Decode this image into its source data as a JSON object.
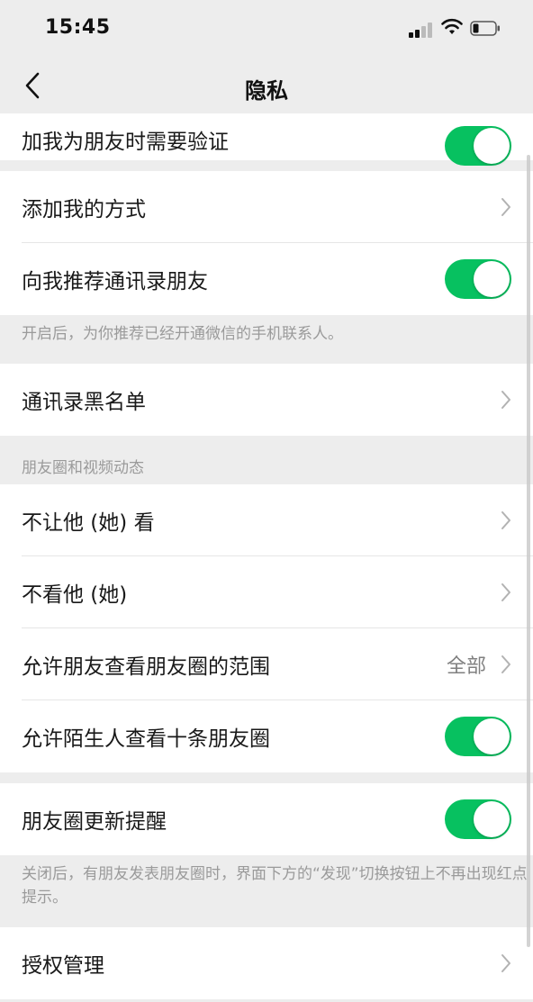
{
  "status_bar": {
    "time": "15:45"
  },
  "nav": {
    "title": "隐私"
  },
  "rows": {
    "verify": {
      "label": "加我为朋友时需要验证",
      "toggle_on": true
    },
    "add_methods": {
      "label": "添加我的方式"
    },
    "recommend_contacts": {
      "label": "向我推荐通讯录朋友",
      "toggle_on": true
    },
    "recommend_note": "开启后，为你推荐已经开通微信的手机联系人。",
    "blacklist": {
      "label": "通讯录黑名单"
    },
    "moments_section_header": "朋友圈和视频动态",
    "dont_let_see": {
      "label": "不让他 (她) 看"
    },
    "dont_see": {
      "label": "不看他 (她)"
    },
    "moments_range": {
      "label": "允许朋友查看朋友圈的范围",
      "value": "全部"
    },
    "stranger_ten": {
      "label": "允许陌生人查看十条朋友圈",
      "toggle_on": true
    },
    "moments_update": {
      "label": "朋友圈更新提醒",
      "toggle_on": true
    },
    "moments_update_note": "关闭后，有朋友发表朋友圈时，界面下方的“发现”切换按钮上不再出现红点提示。",
    "auth_manage": {
      "label": "授权管理"
    }
  },
  "colors": {
    "accent": "#07c160",
    "background": "#ededed"
  },
  "icons": {
    "back": "chevron-left-icon",
    "chevron": "chevron-right-icon",
    "signal": "cellular-signal-icon",
    "wifi": "wifi-icon",
    "battery": "battery-low-icon"
  }
}
